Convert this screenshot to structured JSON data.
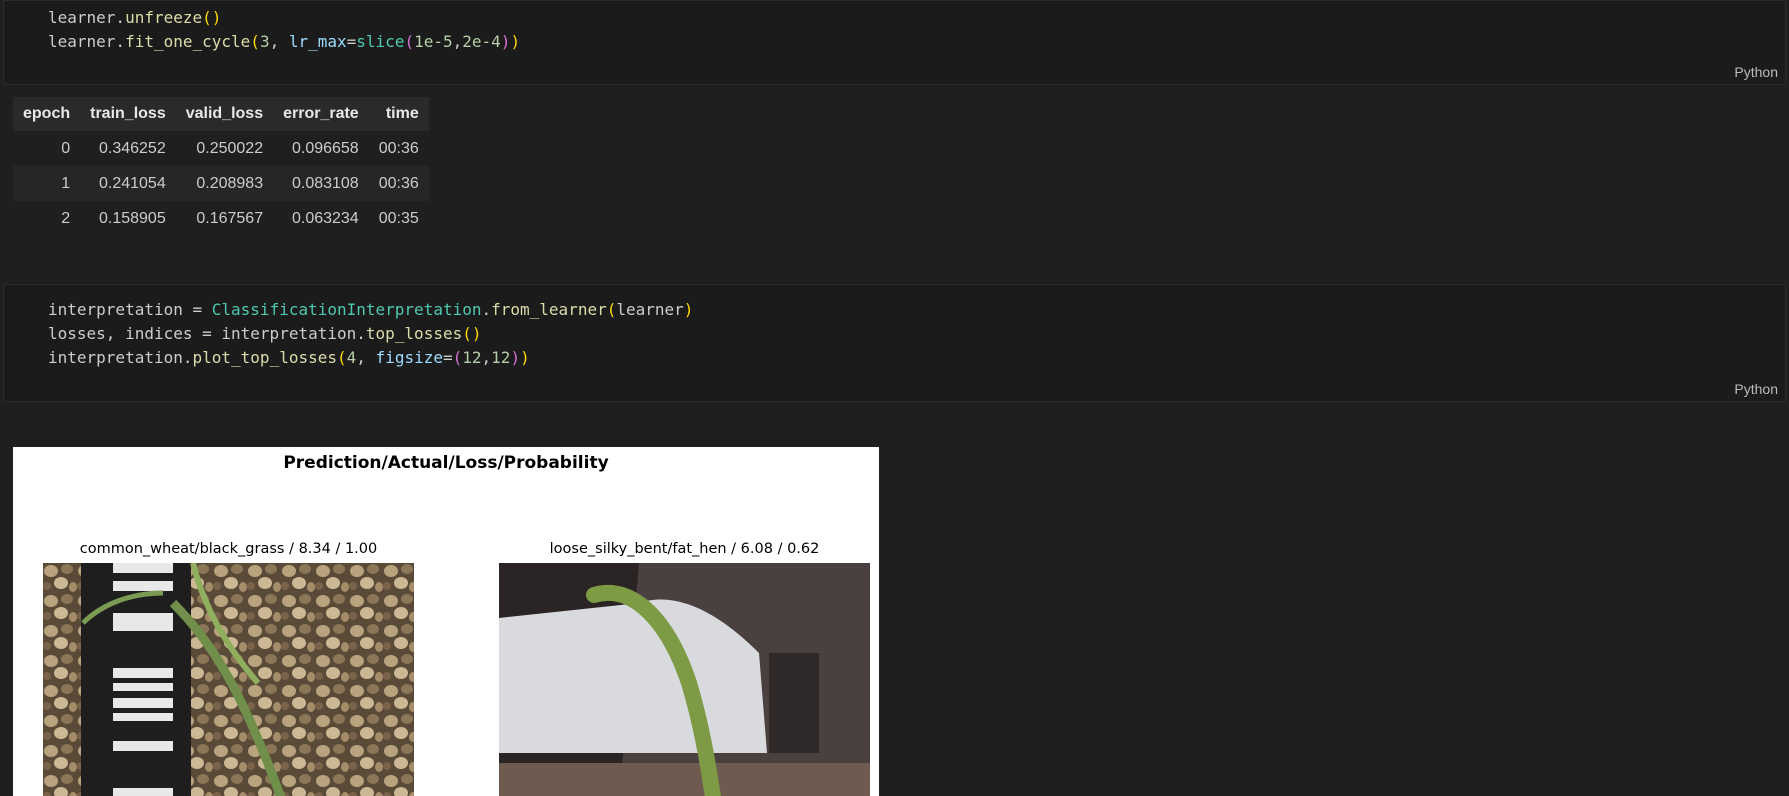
{
  "cells": [
    {
      "language": "Python",
      "code": [
        "learner.unfreeze()",
        "learner.fit_one_cycle(3, lr_max=slice(1e-5,2e-4))"
      ]
    },
    {
      "language": "Python",
      "code": [
        "interpretation = ClassificationInterpretation.from_learner(learner)",
        "losses, indices = interpretation.top_losses()",
        "interpretation.plot_top_losses(4, figsize=(12,12))"
      ]
    }
  ],
  "results_table": {
    "headers": [
      "epoch",
      "train_loss",
      "valid_loss",
      "error_rate",
      "time"
    ],
    "rows": [
      [
        "0",
        "0.346252",
        "0.250022",
        "0.096658",
        "00:36"
      ],
      [
        "1",
        "0.241054",
        "0.208983",
        "0.083108",
        "00:36"
      ],
      [
        "2",
        "0.158905",
        "0.167567",
        "0.063234",
        "00:35"
      ]
    ]
  },
  "plot": {
    "title": "Prediction/Actual/Loss/Probability",
    "subplots": [
      {
        "label": "common_wheat/black_grass / 8.34 / 1.00"
      },
      {
        "label": "loose_silky_bent/fat_hen / 6.08 / 0.62"
      }
    ]
  }
}
